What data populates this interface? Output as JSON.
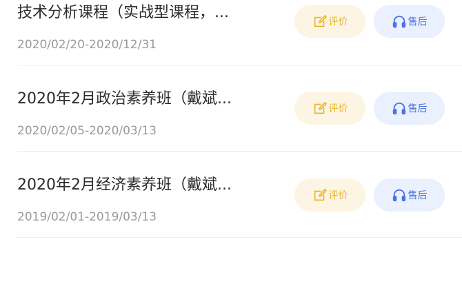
{
  "orders": [
    {
      "title": "技术分析课程（实战型课程，...",
      "date_range": "2020/02/20-2020/12/31",
      "review_label": "评价",
      "service_label": "售后"
    },
    {
      "title": "2020年2月政治素养班（戴斌...",
      "date_range": "2020/02/05-2020/03/13",
      "review_label": "评价",
      "service_label": "售后"
    },
    {
      "title": "2020年2月经济素养班（戴斌...",
      "date_range": "2019/02/01-2019/03/13",
      "review_label": "评价",
      "service_label": "售后"
    }
  ],
  "icons": {
    "review": "edit-icon",
    "service": "headphones-icon"
  },
  "colors": {
    "review_bg": "#fdf5e3",
    "review_fg": "#e8b62e",
    "service_bg": "#eaf0fd",
    "service_fg": "#4a74df"
  }
}
